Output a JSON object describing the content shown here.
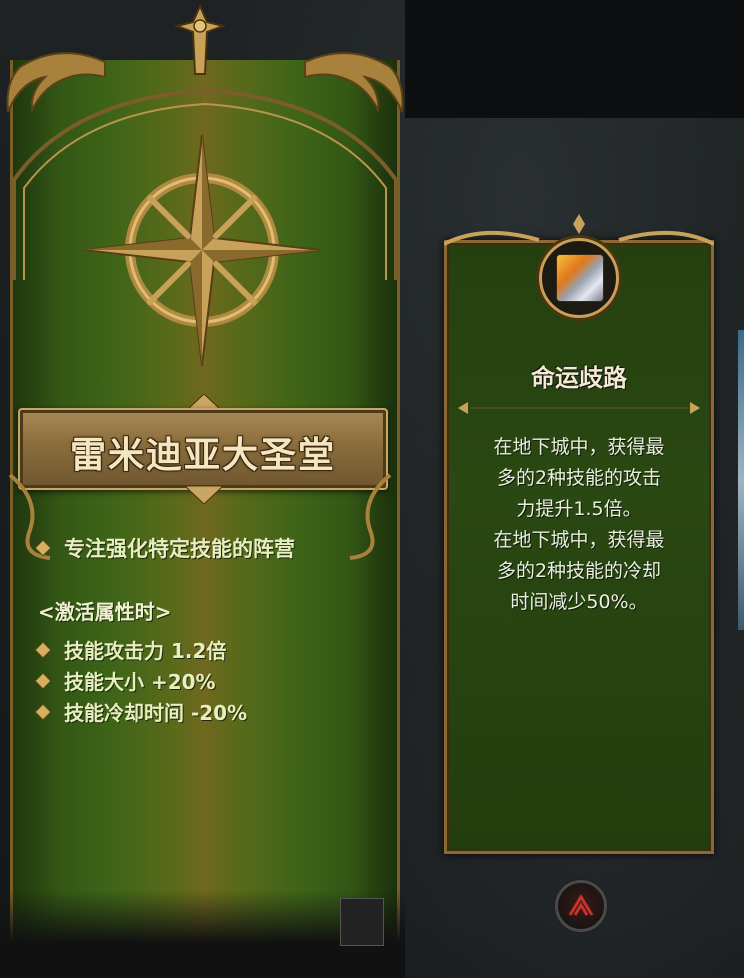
{
  "left_panel": {
    "title": "雷米迪亚大圣堂",
    "description": "专注强化特定技能的阵营",
    "condition_label": "<激活属性时>",
    "stats": [
      "技能攻击力 1.2倍",
      "技能大小 +20%",
      "技能冷却时间 -20%"
    ]
  },
  "right_panel": {
    "title": "命运歧路",
    "body_lines": [
      "在地下城中，获得最",
      "多的2种技能的攻击",
      "力提升1.5倍。",
      "在地下城中，获得最",
      "多的2种技能的冷却",
      "时间减少50%。"
    ]
  },
  "colors": {
    "panel_green": "#3d6418",
    "gold_trim": "#c9a763",
    "text_light": "#e8eec0"
  },
  "icons": [
    "compass-star-emblem-icon",
    "skill-gauntlet-icon",
    "close-icon"
  ]
}
